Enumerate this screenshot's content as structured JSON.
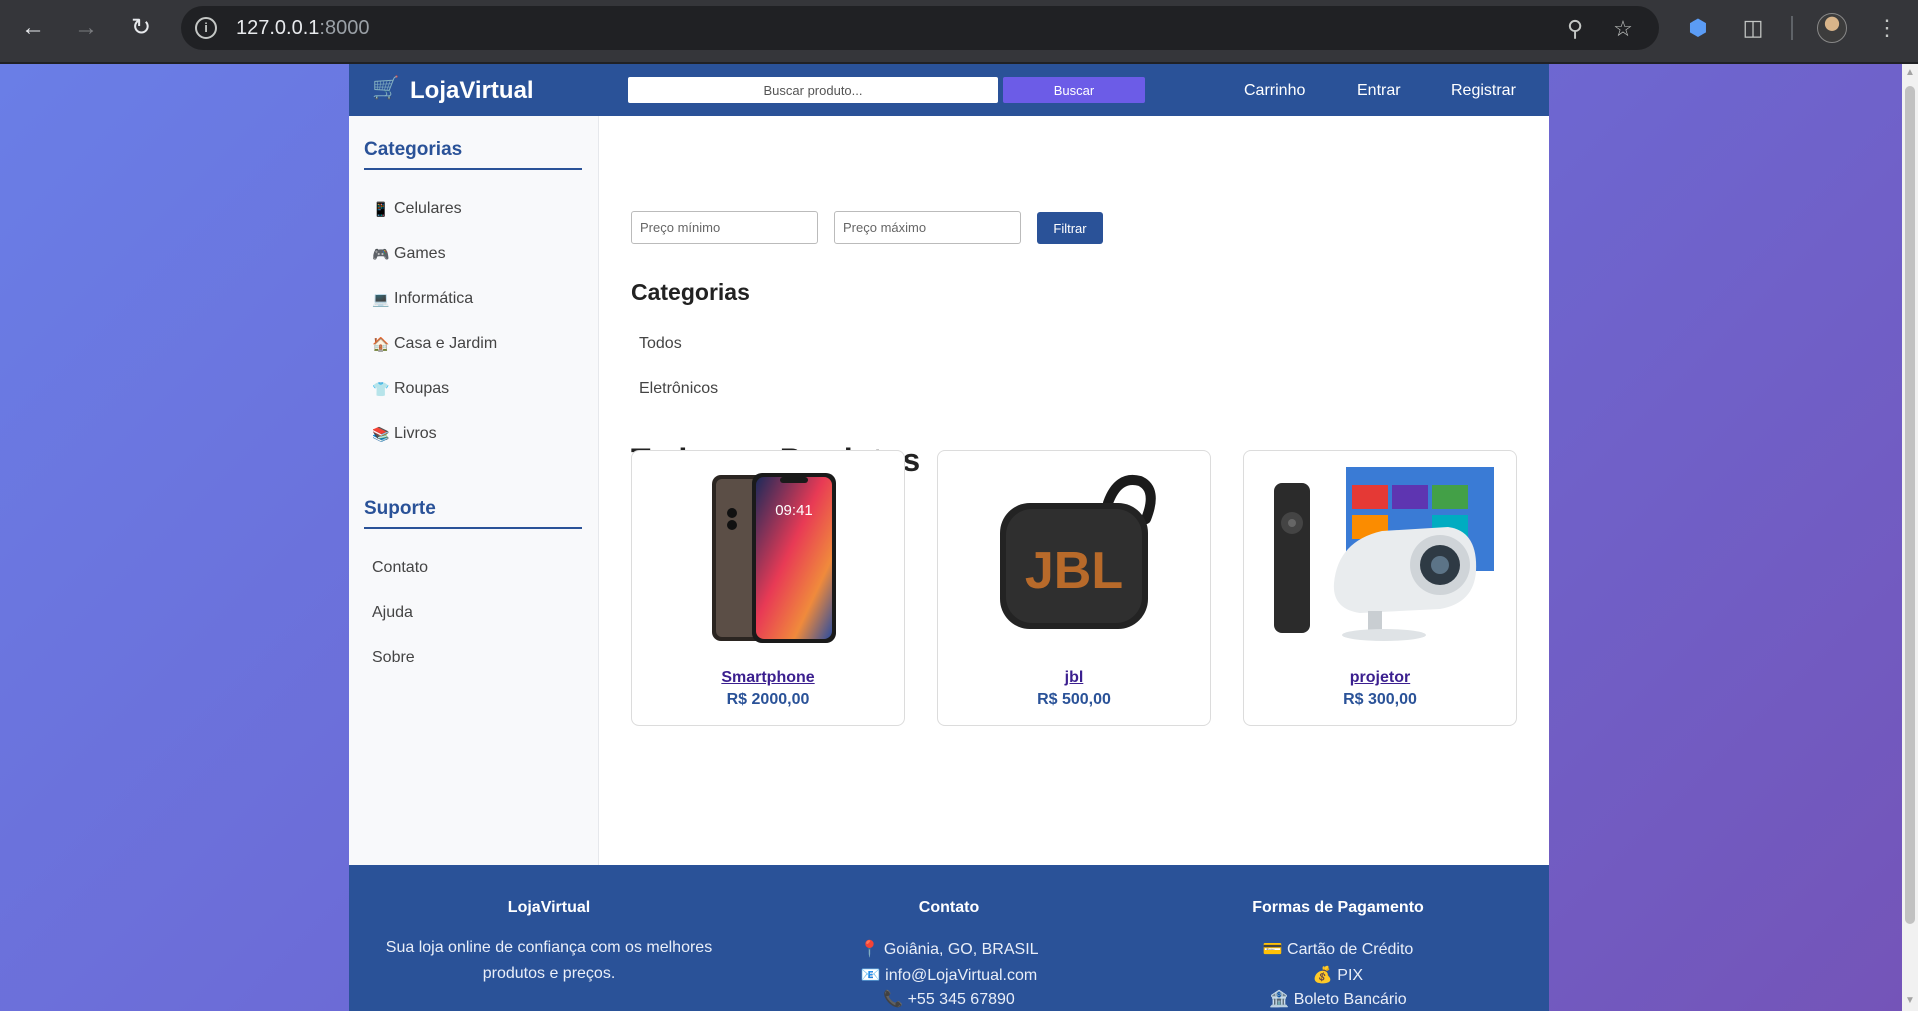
{
  "browser": {
    "url_host": "127.0.0.1",
    "url_port": ":8000",
    "icons": [
      "back-icon",
      "forward-icon",
      "reload-icon",
      "site-info-icon",
      "zoom-icon",
      "bookmark-star-icon",
      "extension-shield-icon",
      "extensions-icon",
      "profile-avatar",
      "menu-icon"
    ]
  },
  "header": {
    "logo": "LojaVirtual",
    "search_placeholder": "Buscar produto...",
    "search_button": "Buscar",
    "links": [
      "Carrinho",
      "Entrar",
      "Registrar"
    ]
  },
  "sidebar": {
    "categories_title": "Categorias",
    "categories": [
      {
        "icon": "📱",
        "label": "Celulares"
      },
      {
        "icon": "🎮",
        "label": "Games"
      },
      {
        "icon": "💻",
        "label": "Informática"
      },
      {
        "icon": "🏠",
        "label": "Casa e Jardim"
      },
      {
        "icon": "👕",
        "label": "Roupas"
      },
      {
        "icon": "📚",
        "label": "Livros"
      }
    ],
    "support_title": "Suporte",
    "support": [
      "Contato",
      "Ajuda",
      "Sobre"
    ]
  },
  "filters": {
    "min_placeholder": "Preço mínimo",
    "max_placeholder": "Preço máximo",
    "button": "Filtrar"
  },
  "categories_section": {
    "title": "Categorias",
    "items": [
      "Todos",
      "Eletrônicos"
    ]
  },
  "products_section": {
    "title": "Todos os Produtos",
    "products": [
      {
        "name": "Smartphone",
        "price": "R$ 2000,00"
      },
      {
        "name": "jbl",
        "price": "R$ 500,00"
      },
      {
        "name": "projetor",
        "price": "R$ 300,00"
      }
    ]
  },
  "footer": {
    "about_title": "LojaVirtual",
    "about_text_1": "Sua loja online de confiança com os melhores",
    "about_text_2": "produtos e preços.",
    "contact_title": "Contato",
    "contact": [
      {
        "icon": "📍",
        "text": "Goiânia, GO, BRASIL"
      },
      {
        "icon": "📧",
        "text": "info@LojaVirtual.com"
      },
      {
        "icon": "📞",
        "text": "+55 345 67890"
      }
    ],
    "payment_title": "Formas de Pagamento",
    "payment": [
      {
        "icon": "💳",
        "text": "Cartão de Crédito"
      },
      {
        "icon": "💰",
        "text": "PIX"
      },
      {
        "icon": "🏦",
        "text": "Boleto Bancário"
      }
    ]
  },
  "colors": {
    "brand": "#2a5298",
    "accent": "#6c5ce7",
    "product_link": "#3b1f8f"
  }
}
